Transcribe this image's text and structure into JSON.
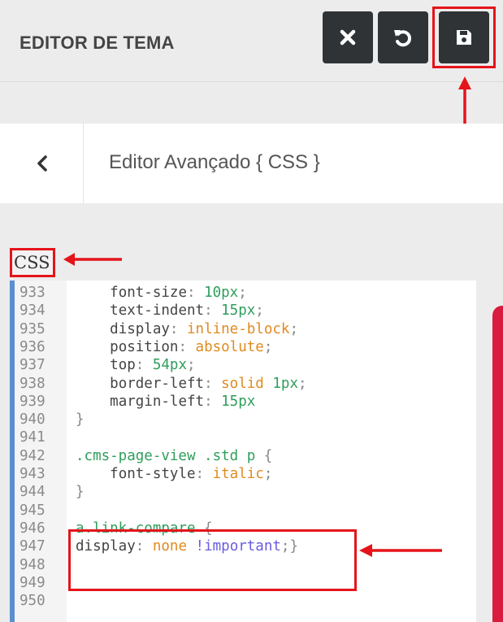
{
  "header": {
    "title": "EDITOR DE TEMA"
  },
  "toolbar": {
    "close_icon": "close-icon",
    "undo_icon": "undo-icon",
    "save_icon": "save-icon"
  },
  "subheader": {
    "back_icon": "chevron-left-icon",
    "title": "Editor Avançado { CSS }"
  },
  "editor": {
    "label": "CSS",
    "lines": [
      {
        "n": "933",
        "parts": [
          [
            "    ",
            ""
          ],
          [
            "font-size",
            "prop"
          ],
          [
            ": ",
            "pun"
          ],
          [
            "10px",
            "num"
          ],
          [
            ";",
            "pun"
          ]
        ]
      },
      {
        "n": "934",
        "parts": [
          [
            "    ",
            ""
          ],
          [
            "text-indent",
            "prop"
          ],
          [
            ": ",
            "pun"
          ],
          [
            "15px",
            "num"
          ],
          [
            ";",
            "pun"
          ]
        ]
      },
      {
        "n": "935",
        "parts": [
          [
            "    ",
            ""
          ],
          [
            "display",
            "prop"
          ],
          [
            ": ",
            "pun"
          ],
          [
            "inline-block",
            "val"
          ],
          [
            ";",
            "pun"
          ]
        ]
      },
      {
        "n": "936",
        "parts": [
          [
            "    ",
            ""
          ],
          [
            "position",
            "prop"
          ],
          [
            ": ",
            "pun"
          ],
          [
            "absolute",
            "val"
          ],
          [
            ";",
            "pun"
          ]
        ]
      },
      {
        "n": "937",
        "parts": [
          [
            "    ",
            ""
          ],
          [
            "top",
            "prop"
          ],
          [
            ": ",
            "pun"
          ],
          [
            "54px",
            "num"
          ],
          [
            ";",
            "pun"
          ]
        ]
      },
      {
        "n": "938",
        "parts": [
          [
            "    ",
            ""
          ],
          [
            "border-left",
            "prop"
          ],
          [
            ": ",
            "pun"
          ],
          [
            "solid",
            "val"
          ],
          [
            " ",
            ""
          ],
          [
            "1px",
            "num"
          ],
          [
            ";",
            "pun"
          ]
        ]
      },
      {
        "n": "939",
        "parts": [
          [
            "    ",
            ""
          ],
          [
            "margin-left",
            "prop"
          ],
          [
            ": ",
            "pun"
          ],
          [
            "15px",
            "num"
          ]
        ]
      },
      {
        "n": "940",
        "parts": [
          [
            "}",
            "pun"
          ]
        ]
      },
      {
        "n": "941",
        "parts": []
      },
      {
        "n": "942",
        "parts": [
          [
            ".cms-page-view .std p ",
            "sel"
          ],
          [
            "{",
            "pun"
          ]
        ]
      },
      {
        "n": "943",
        "parts": [
          [
            "    ",
            ""
          ],
          [
            "font-style",
            "prop"
          ],
          [
            ": ",
            "pun"
          ],
          [
            "italic",
            "val"
          ],
          [
            ";",
            "pun"
          ]
        ]
      },
      {
        "n": "944",
        "parts": [
          [
            "}",
            "pun"
          ]
        ]
      },
      {
        "n": "945",
        "parts": []
      },
      {
        "n": "946",
        "parts": [
          [
            "a.link-compare ",
            "sel"
          ],
          [
            "{",
            "pun"
          ]
        ]
      },
      {
        "n": "947",
        "parts": [
          [
            "display",
            "prop"
          ],
          [
            ": ",
            "pun"
          ],
          [
            "none",
            "val"
          ],
          [
            " ",
            ""
          ],
          [
            "!important",
            "kw"
          ],
          [
            ";}",
            "pun"
          ]
        ]
      },
      {
        "n": "948",
        "parts": []
      },
      {
        "n": "949",
        "parts": []
      },
      {
        "n": "950",
        "parts": []
      }
    ]
  },
  "colors": {
    "annotation_red": "#e5141a",
    "gutter_blue": "#5a8fd0",
    "accent_pink": "#d81b3f",
    "button_dark": "#2f3336"
  }
}
